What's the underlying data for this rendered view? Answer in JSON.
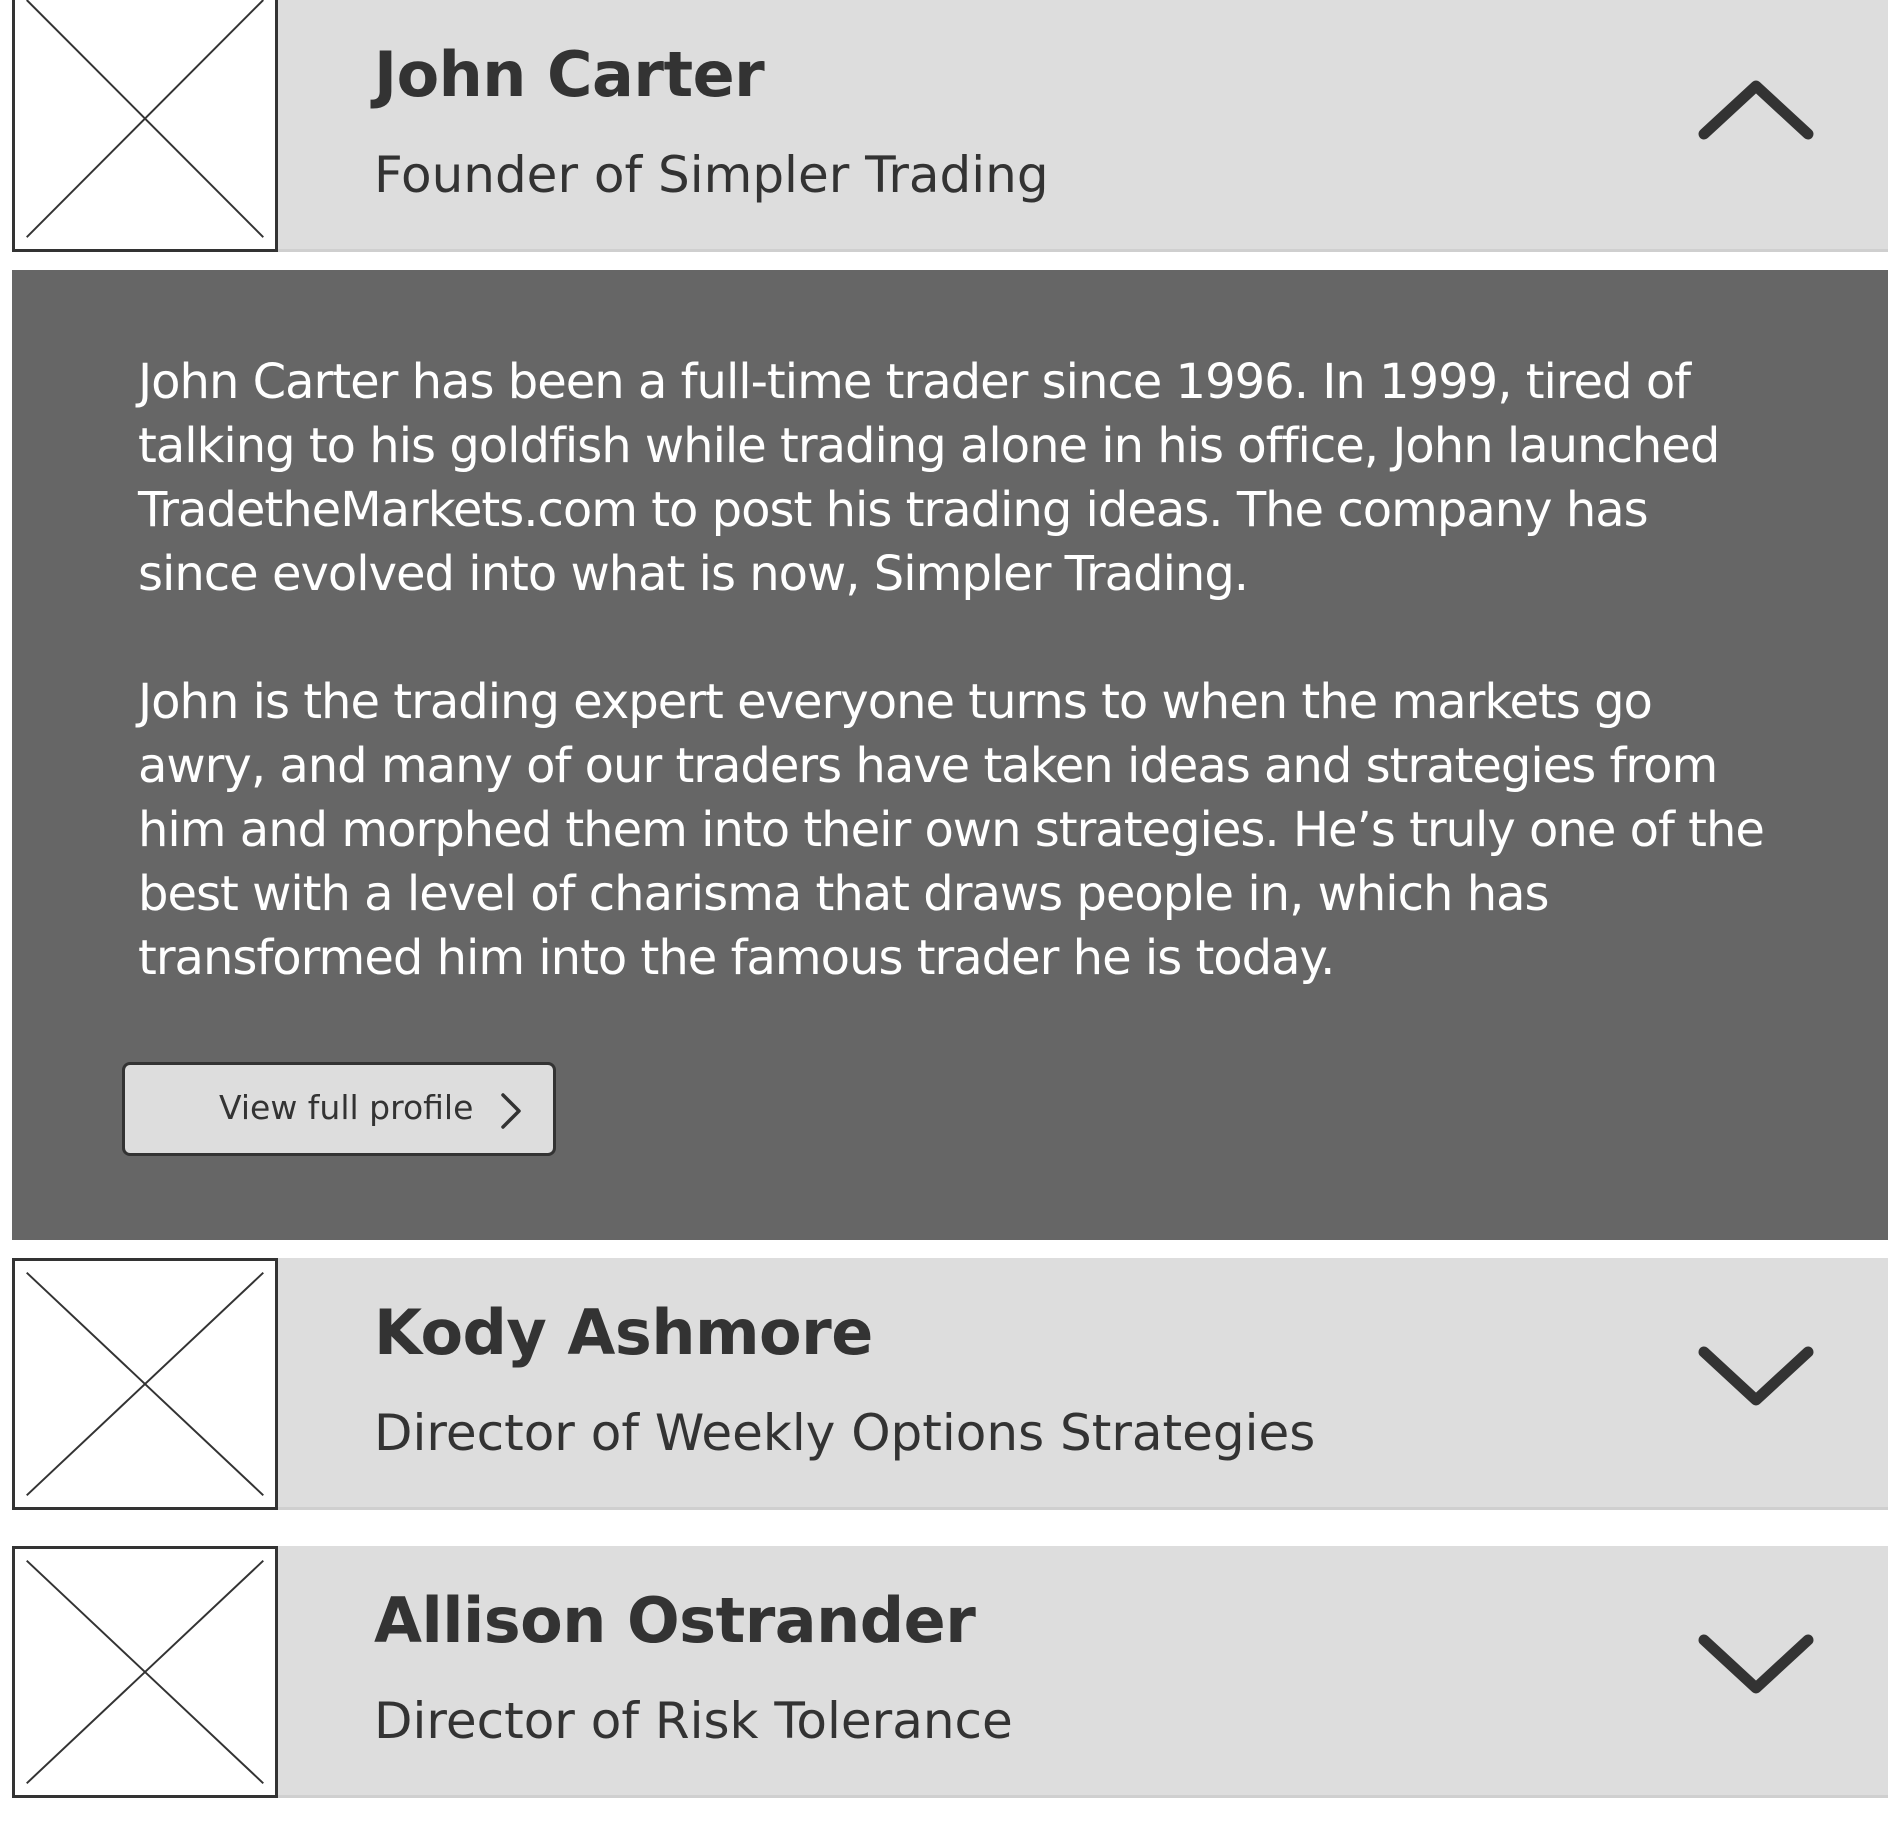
{
  "people": [
    {
      "name": "John Carter",
      "title": "Founder of Simpler Trading",
      "expanded": true,
      "toggle_icon": "chevron-up-icon",
      "bio": [
        "John Carter has been a full-time trader since 1996. In 1999, tired of talking to his goldfish while trading alone in his office, John launched TradetheMarkets.com to post his trading ideas. The company has since evolved into what is now, Simpler Trading.",
        "John is the trading expert everyone turns to when the markets go awry, and many of our traders have taken ideas and strategies from him and morphed them into their own strategies. He’s truly one of the best with a level of charisma that draws people in, which has transformed him into the famous trader he is today."
      ],
      "profile_button_label": "View full profile",
      "profile_button_icon": "chevron-right-icon"
    },
    {
      "name": "Kody Ashmore",
      "title": "Director of Weekly Options Strategies",
      "expanded": false,
      "toggle_icon": "chevron-down-icon"
    },
    {
      "name": "Allison Ostrander",
      "title": "Director of Risk Tolerance",
      "expanded": false,
      "toggle_icon": "chevron-down-icon"
    }
  ],
  "colors": {
    "row_background": "#dddddd",
    "expanded_background": "#666666",
    "text_dark": "#333333",
    "text_light": "#ffffff"
  }
}
